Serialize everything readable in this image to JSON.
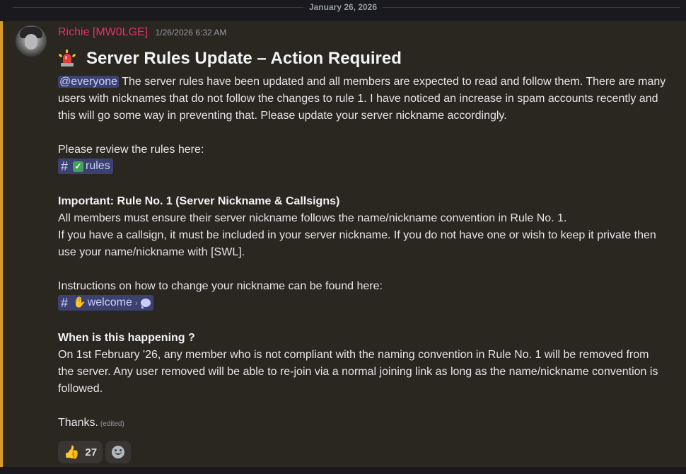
{
  "divider": {
    "date": "January 26, 2026"
  },
  "message": {
    "author": "Richie [MW0LGE]",
    "timestamp": "1/26/2026 6:32 AM",
    "headline": "Server Rules Update – Action Required",
    "mention": "@everyone",
    "intro": " The server rules have been updated and all members are expected to read and follow them. There are many users with nicknames that do not follow the changes to rule 1. I have noticed an increase in spam accounts recently and this will go some way in preventing that. Please update your server nickname accordingly.",
    "review_text": "Please review the rules here:",
    "rules_channel": "rules",
    "important_heading": "Important: Rule No. 1 (Server Nickname & Callsigns)",
    "important_line1": "All members must ensure their server nickname follows the name/nickname convention in Rule No. 1.",
    "important_line2": "If you have a callsign, it must be included in your server nickname. If you do not have one or wish to keep it private then use your name/nickname with [SWL].",
    "instructions_text": "Instructions on how to change your nickname can be found here:",
    "welcome_channel": "welcome",
    "when_heading": "When is this happening ?",
    "when_text": "On 1st February '26, any member who is not compliant with the naming convention in Rule No. 1 will be removed from the server. Any user removed will be able to re-join via a normal joining link as long as the name/nickname convention is followed.",
    "thanks": "Thanks.",
    "edited": "(edited)"
  },
  "reactions": [
    {
      "icon": "thumbs-up-icon",
      "count": "27"
    }
  ],
  "colors": {
    "author": "#e0336a",
    "highlight_border": "#d79b2b",
    "mention_bg": "#3c4270"
  }
}
